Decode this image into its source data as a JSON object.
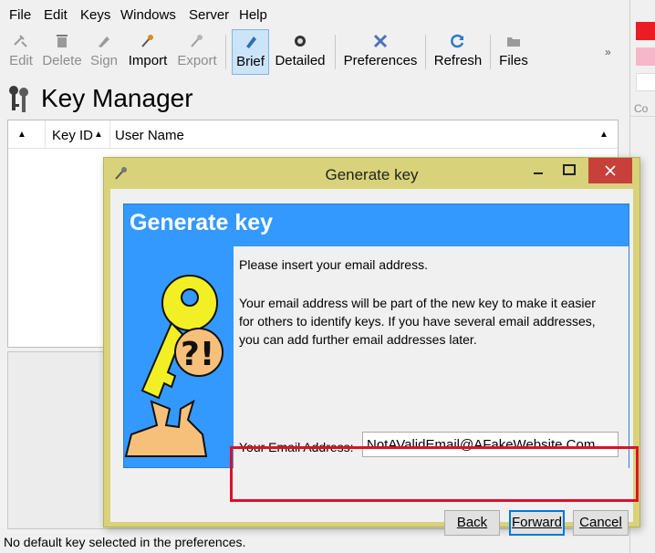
{
  "menu": [
    "File",
    "Edit",
    "Keys",
    "Windows",
    "Server",
    "Help"
  ],
  "toolbar": {
    "edit": "Edit",
    "delete": "Delete",
    "sign": "Sign",
    "import": "Import",
    "export": "Export",
    "brief": "Brief",
    "detailed": "Detailed",
    "preferences": "Preferences",
    "refresh": "Refresh",
    "files": "Files",
    "more": "»"
  },
  "page_title": "Key Manager",
  "table": {
    "col_keyid": "Key ID",
    "col_username": "User Name"
  },
  "statusbar": "No default key selected in the preferences.",
  "right_strip": {
    "label": "Co",
    "swatch_colors": [
      "#ea1c24",
      "#f7b6c9",
      "#ffffff"
    ]
  },
  "dialog": {
    "title": "Generate key",
    "heading": "Generate key",
    "intro": "Please insert your email address.",
    "description": "Your email address will be part of the new key to make it easier for others to identify keys. If you have several email addresses, you can add further email addresses later.",
    "email_label": "Your Email Address:",
    "email_value": "NotAValidEmail@AFakeWebsite.Com",
    "back": "Back",
    "forward": "Forward",
    "cancel": "Cancel",
    "accent": "#3399ff",
    "frame_color": "#d8d27a",
    "highlight_color": "#d9122a"
  }
}
